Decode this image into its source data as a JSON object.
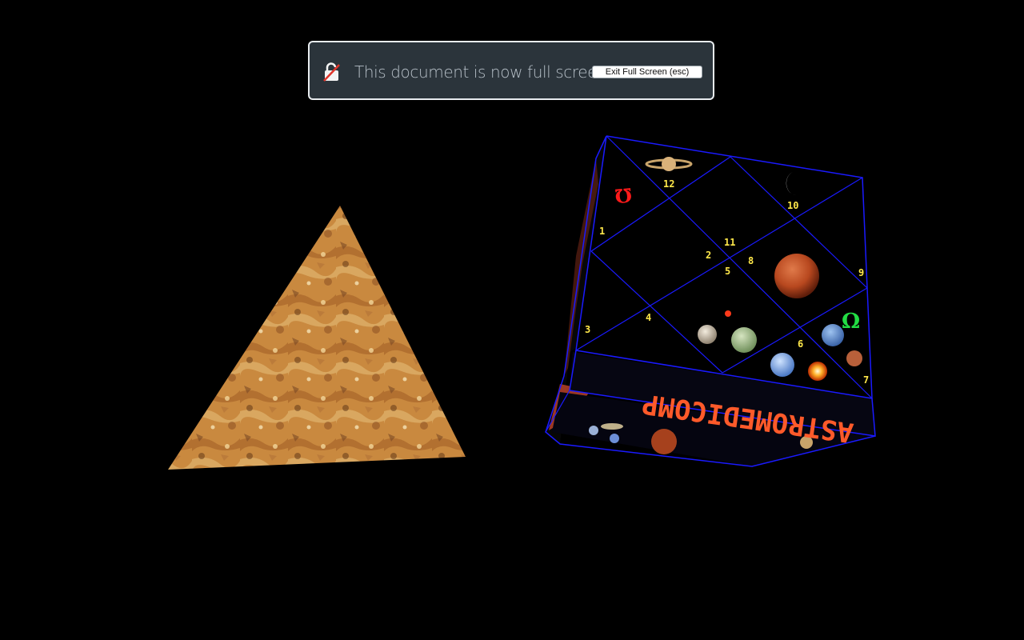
{
  "banner": {
    "message": "This document is now full screen",
    "exit_button_label": "Exit Full Screen (esc)",
    "icon": "unlock-icon"
  },
  "scene": {
    "pyramid_texture": "rock-texture",
    "cube": {
      "brand_text": "ASTROMEDICOMP",
      "house_numbers": [
        "1",
        "2",
        "3",
        "4",
        "5",
        "6",
        "7",
        "8",
        "9",
        "10",
        "11",
        "12"
      ],
      "symbol_red": "Ω",
      "symbol_green": "Ω",
      "edge_color": "#1a1aff",
      "brand_color": "#ff5a2a"
    }
  }
}
